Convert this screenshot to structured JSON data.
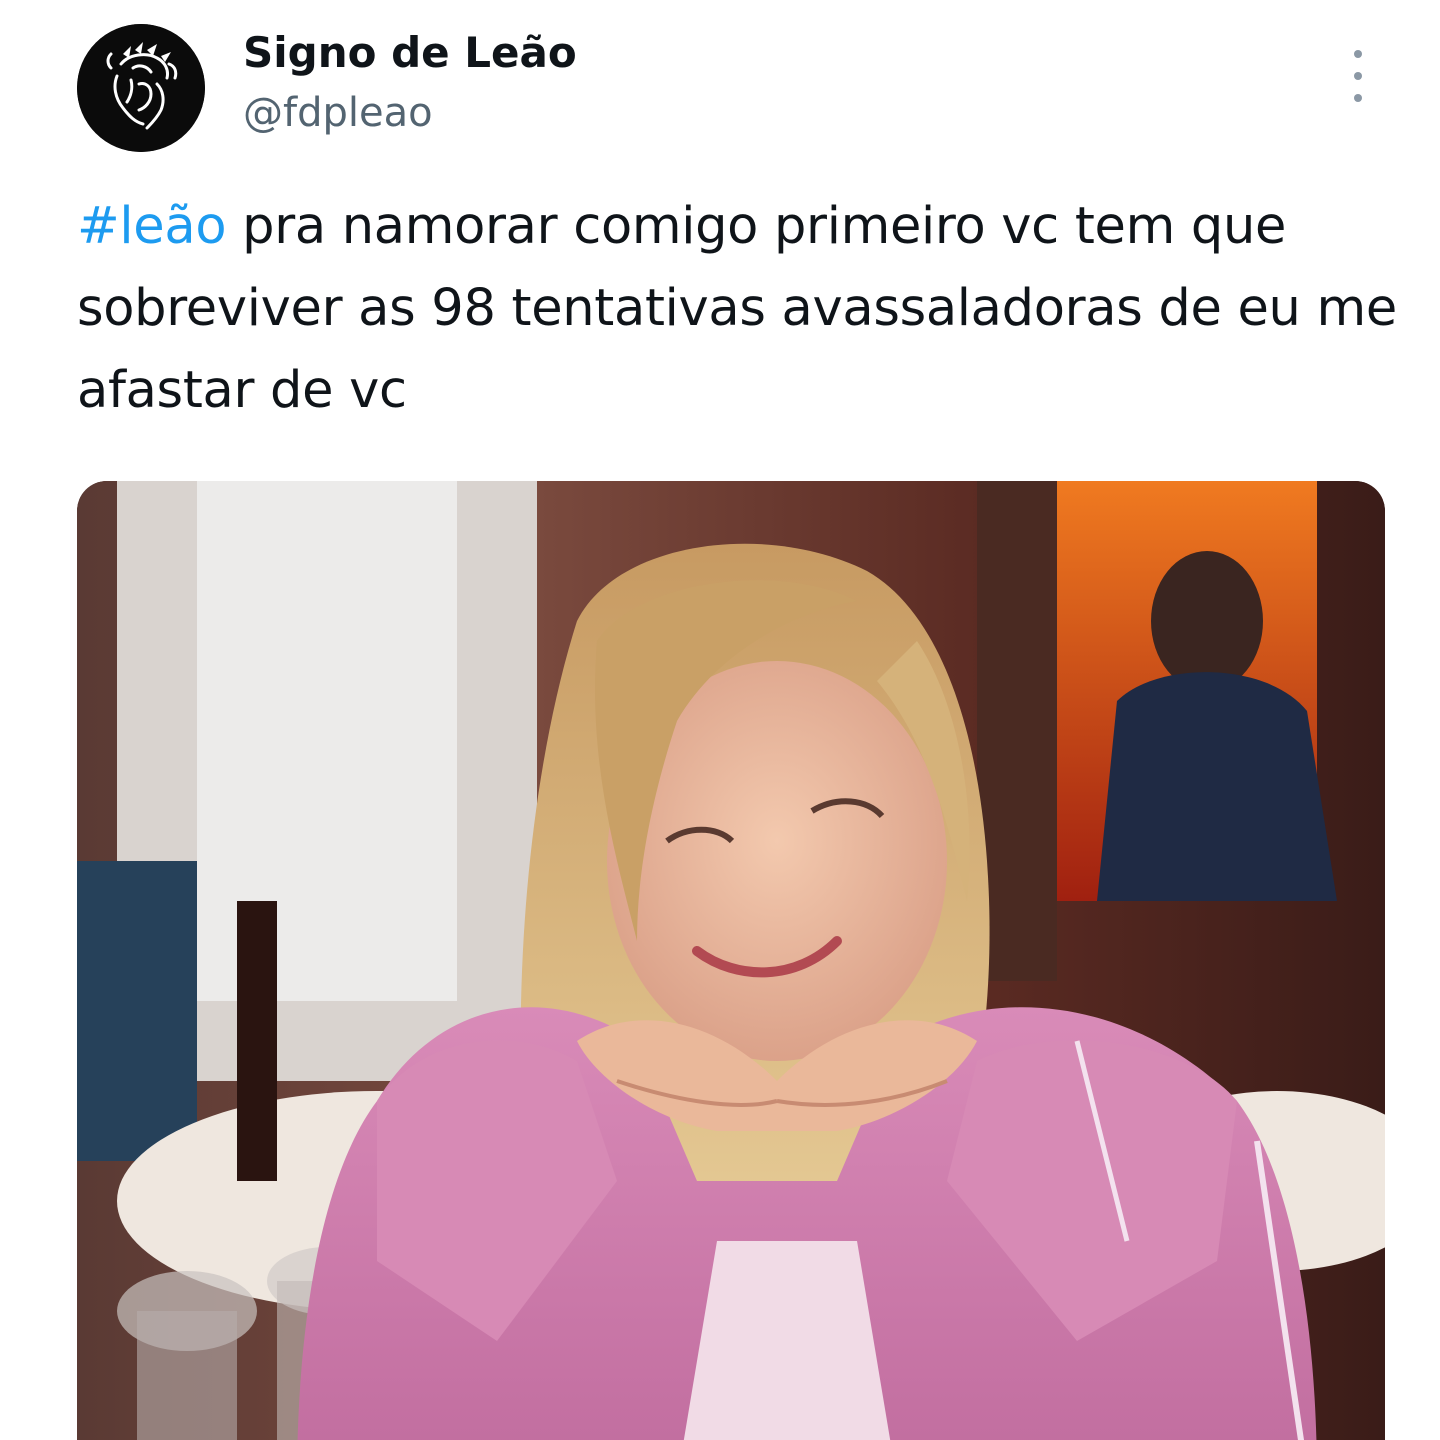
{
  "tweet": {
    "author": {
      "display_name": "Signo de Leão",
      "handle": "@fdpleao",
      "avatar_icon": "lion-head-icon"
    },
    "more_icon": "more-vertical-icon",
    "hashtag": "#leão",
    "text": " pra namorar comigo primeiro vc tem que sobreviver as 98 tentativas avassaladoras de eu me afastar de vc",
    "media": {
      "type": "photo",
      "content": "blonde woman in pink jacket resting chin on hands at restaurant table"
    },
    "colors": {
      "text": "#0f1419",
      "secondary": "#536471",
      "hashtag": "#1d9bf0",
      "background": "#ffffff"
    }
  }
}
